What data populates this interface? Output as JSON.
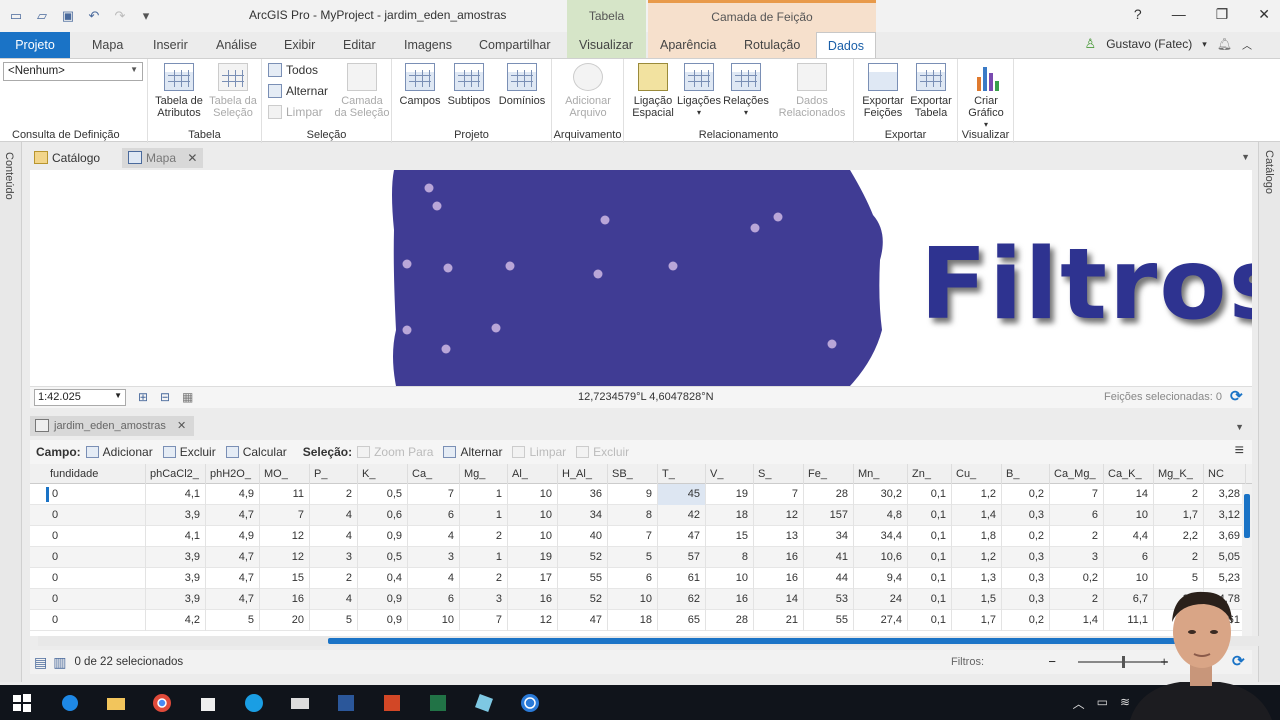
{
  "window": {
    "title": "ArcGIS Pro - MyProject - jardim_eden_amostras",
    "context_tabela": "Tabela",
    "context_camada": "Camada de Feição",
    "help": "?",
    "minimize": "—",
    "maximize": "❐",
    "close": "✕"
  },
  "ribbon_tabs": [
    "Projeto",
    "Mapa",
    "Inserir",
    "Análise",
    "Exibir",
    "Editar",
    "Imagens",
    "Compartilhar",
    "Visualizar",
    "Aparência",
    "Rotulação",
    "Dados"
  ],
  "user": {
    "name": "Gustavo (Fatec)",
    "caret": "▾"
  },
  "ribbon": {
    "definition_query": {
      "value": "<Nenhum>",
      "label": "Consulta de Definição"
    },
    "tabela": {
      "label": "Tabela",
      "atributos": "Tabela de Atributos",
      "selecao": "Tabela da Seleção"
    },
    "selecao": {
      "label": "Seleção",
      "todos": "Todos",
      "alternar": "Alternar",
      "limpar": "Limpar",
      "camada": "Camada da Seleção"
    },
    "projeto": {
      "label": "Projeto",
      "campos": "Campos",
      "subtipos": "Subtipos",
      "dominios": "Domínios"
    },
    "arquivamento": {
      "label": "Arquivamento",
      "adicionar": "Adicionar Arquivo"
    },
    "relacionamento": {
      "label": "Relacionamento",
      "ligacao": "Ligação Espacial",
      "ligacoes": "Ligações",
      "relacoes": "Relações",
      "dados_rel": "Dados Relacionados"
    },
    "exportar": {
      "label": "Exportar",
      "feicoes": "Exportar Feições",
      "tabela": "Exportar Tabela"
    },
    "visualizar": {
      "label": "Visualizar",
      "criar": "Criar Gráfico"
    }
  },
  "side": {
    "left": "Conteúdo",
    "right": "Catálogo"
  },
  "view_tabs": [
    {
      "label": "Catálogo"
    },
    {
      "label": "Mapa"
    }
  ],
  "map": {
    "overlay_text": "Filtros",
    "scale": "1:42.025",
    "coords": "12,7234579°L 4,6047828°N",
    "selected_features": "Feições selecionadas: 0",
    "colors": {
      "polygon": "#403c94",
      "point": "#b9a6d8"
    }
  },
  "table_tab": "jardim_eden_amostras",
  "table_toolbar": {
    "campo": "Campo:",
    "adicionar": "Adicionar",
    "excluir": "Excluir",
    "calcular": "Calcular",
    "selecao": "Seleção:",
    "zoom": "Zoom Para",
    "alternar": "Alternar",
    "limpar": "Limpar",
    "excluir2": "Excluir"
  },
  "table": {
    "columns": [
      "fundidade",
      "phCaCl2_",
      "phH2O_",
      "MO_",
      "P_",
      "K_",
      "Ca_",
      "Mg_",
      "Al_",
      "H_Al_",
      "SB_",
      "T_",
      "V_",
      "S_",
      "Fe_",
      "Mn_",
      "Zn_",
      "Cu_",
      "B_",
      "Ca_Mg_",
      "Ca_K_",
      "Mg_K_",
      "NC"
    ],
    "rows": [
      [
        "0",
        "4,1",
        "4,9",
        "11",
        "2",
        "0,5",
        "7",
        "1",
        "10",
        "36",
        "9",
        "45",
        "19",
        "7",
        "28",
        "30,2",
        "0,1",
        "1,2",
        "0,2",
        "7",
        "14",
        "2",
        "3,28"
      ],
      [
        "0",
        "3,9",
        "4,7",
        "7",
        "4",
        "0,6",
        "6",
        "1",
        "10",
        "34",
        "8",
        "42",
        "18",
        "12",
        "157",
        "4,8",
        "0,1",
        "1,4",
        "0,3",
        "6",
        "10",
        "1,7",
        "3,12"
      ],
      [
        "0",
        "4,1",
        "4,9",
        "12",
        "4",
        "0,9",
        "4",
        "2",
        "10",
        "40",
        "7",
        "47",
        "15",
        "13",
        "34",
        "34,4",
        "0,1",
        "1,8",
        "0,2",
        "2",
        "4,4",
        "2,2",
        "3,69"
      ],
      [
        "0",
        "3,9",
        "4,7",
        "12",
        "3",
        "0,5",
        "3",
        "1",
        "19",
        "52",
        "5",
        "57",
        "8",
        "16",
        "41",
        "10,6",
        "0,1",
        "1,2",
        "0,3",
        "3",
        "6",
        "2",
        "5,05"
      ],
      [
        "0",
        "3,9",
        "4,7",
        "15",
        "2",
        "0,4",
        "4",
        "2",
        "17",
        "55",
        "6",
        "61",
        "10",
        "16",
        "44",
        "9,4",
        "0,1",
        "1,3",
        "0,3",
        "0,2",
        "10",
        "5",
        "5,23"
      ],
      [
        "0",
        "3,9",
        "4,7",
        "16",
        "4",
        "0,9",
        "6",
        "3",
        "16",
        "52",
        "10",
        "62",
        "16",
        "14",
        "53",
        "24",
        "0,1",
        "1,5",
        "0,3",
        "2",
        "6,7",
        "3,3",
        "4,78"
      ],
      [
        "0",
        "4,2",
        "5",
        "20",
        "5",
        "0,9",
        "10",
        "7",
        "12",
        "47",
        "18",
        "65",
        "28",
        "21",
        "55",
        "27,4",
        "0,1",
        "1,7",
        "0,2",
        "1,4",
        "11,1",
        "7,8",
        "3,61"
      ]
    ]
  },
  "status": {
    "selected": "0 de 22 selecionados",
    "filtros": "Filtros:",
    "zoom_minus": "−",
    "zoom_plus": "+"
  }
}
